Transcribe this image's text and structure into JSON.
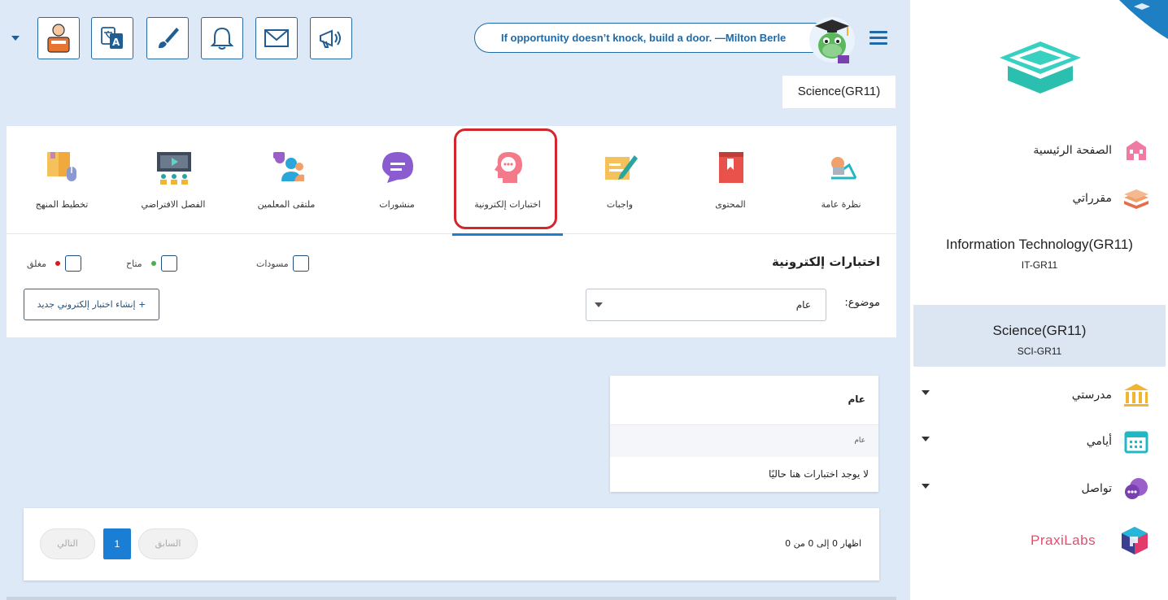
{
  "top_bar": {
    "quote": "If opportunity doesn’t knock, build a door. —Milton Berle",
    "icons": [
      "caret-down-icon",
      "teacher-avatar-icon",
      "translate-icon",
      "brush-icon",
      "bell-icon",
      "mail-icon",
      "megaphone-icon"
    ],
    "breadcrumb": "Science(GR11)"
  },
  "tabs": [
    {
      "label": "نظرة عامة",
      "icon": "overview-icon"
    },
    {
      "label": "المحتوى",
      "icon": "book-icon"
    },
    {
      "label": "واجبات",
      "icon": "assignment-icon"
    },
    {
      "label": "اختبارات إلكترونية",
      "icon": "quiz-head-icon",
      "active": true
    },
    {
      "label": "منشورات",
      "icon": "chat-bubble-icon"
    },
    {
      "label": "ملتقى المعلمين",
      "icon": "teachers-forum-icon"
    },
    {
      "label": "الفصل الافتراضي",
      "icon": "virtual-class-icon"
    },
    {
      "label": "تخطيط المنهج",
      "icon": "curriculum-planning-icon"
    }
  ],
  "quizzes": {
    "title": "اختبارات إلكترونية",
    "legend": [
      {
        "label": "مسودات",
        "color": ""
      },
      {
        "label": "متاح",
        "color": "#4caf50"
      },
      {
        "label": "مغلق",
        "color": "#d81b1b"
      }
    ],
    "topic_label": "موضوع:",
    "topic_value": "عام",
    "new_button": "+ إنشاء اختبار إلكتروني جديد"
  },
  "group": {
    "header": "عام",
    "sub": "عام",
    "empty": "لا يوجد اختبارات هنا حاليًا"
  },
  "pagination": {
    "info": "اظهار 0 إلى 0 من 0",
    "prev": "السابق",
    "current": "1",
    "next": "التالي"
  },
  "sidebar": {
    "home": "الصفحة الرئيسية",
    "courses": "مقرراتي",
    "course1_name": "Information Technology(GR11)",
    "course1_code": "IT-GR11",
    "course2_name": "Science(GR11)",
    "course2_code": "SCI-GR11",
    "school": "مدرستي",
    "days": "أيامي",
    "contact": "تواصل",
    "praxi": "PraxiLabs"
  },
  "colors": {
    "accent": "#1a7fd4",
    "brand_teal": "#2ec4b6",
    "highlight": "#d3272e"
  }
}
